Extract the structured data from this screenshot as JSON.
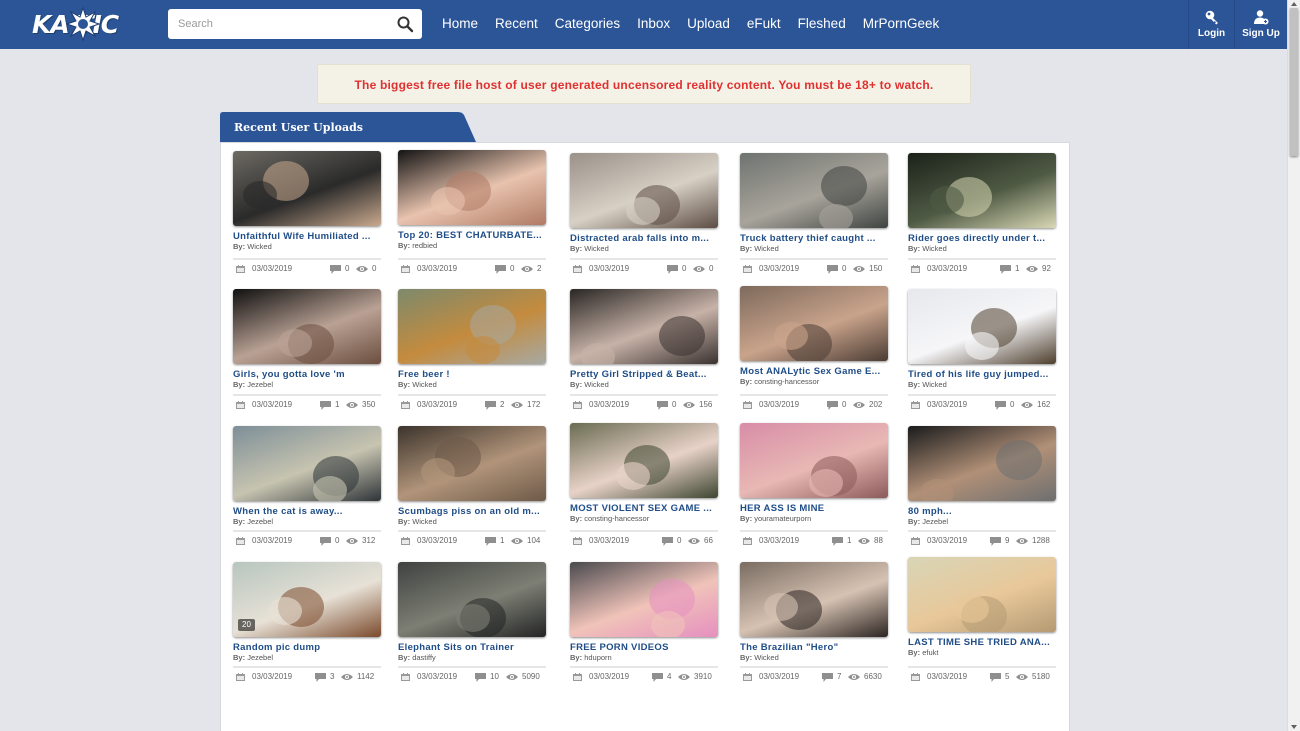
{
  "header": {
    "logo_text": "KA TIC",
    "search": {
      "placeholder": "Search",
      "value": ""
    },
    "nav": [
      "Home",
      "Recent",
      "Categories",
      "Inbox",
      "Upload",
      "eFukt",
      "Fleshed",
      "MrPornGeek"
    ],
    "login_label": "Login",
    "signup_label": "Sign Up",
    "icons": {
      "search": "search-icon",
      "login": "key-icon",
      "signup": "add-user-icon"
    }
  },
  "notice": "The biggest free file host of user generated uncensored reality content. You must be 18+ to watch.",
  "panel": {
    "title": "Recent User Uploads"
  },
  "colors": {
    "header": "#2b5597",
    "link": "#1f4d87",
    "notice_text": "#e03131",
    "notice_bg": "#f4f1e6",
    "page_bg": "#e3e5ea"
  },
  "by_prefix": "By:",
  "uploads": [
    {
      "title": "Unfaithful Wife Humiliated ...",
      "by": "Wicked",
      "date": "03/03/2019",
      "comments": "0",
      "views": "0"
    },
    {
      "title": "Top 20: BEST CHATURBATE...",
      "by": "redbied",
      "date": "03/03/2019",
      "comments": "0",
      "views": "2"
    },
    {
      "title": "Distracted arab falls into m...",
      "by": "Wicked",
      "date": "03/03/2019",
      "comments": "0",
      "views": "0"
    },
    {
      "title": "Truck battery thief caught ...",
      "by": "Wicked",
      "date": "03/03/2019",
      "comments": "0",
      "views": "150"
    },
    {
      "title": "Rider goes directly under t...",
      "by": "Wicked",
      "date": "03/03/2019",
      "comments": "1",
      "views": "92"
    },
    {
      "title": "Girls, you gotta love 'm",
      "by": "Jezebel",
      "date": "03/03/2019",
      "comments": "1",
      "views": "350"
    },
    {
      "title": "Free beer !",
      "by": "Wicked",
      "date": "03/03/2019",
      "comments": "2",
      "views": "172"
    },
    {
      "title": "Pretty Girl Stripped & Beat...",
      "by": "Wicked",
      "date": "03/03/2019",
      "comments": "0",
      "views": "156"
    },
    {
      "title": "Most ANALytic Sex Game E...",
      "by": "consting-hancessor",
      "date": "03/03/2019",
      "comments": "0",
      "views": "202"
    },
    {
      "title": "Tired of his life guy jumped...",
      "by": "Wicked",
      "date": "03/03/2019",
      "comments": "0",
      "views": "162"
    },
    {
      "title": "When the cat is away...",
      "by": "Jezebel",
      "date": "03/03/2019",
      "comments": "0",
      "views": "312"
    },
    {
      "title": "Scumbags piss on an old m...",
      "by": "Wicked",
      "date": "03/03/2019",
      "comments": "1",
      "views": "104"
    },
    {
      "title": "MOST VIOLENT SEX GAME ...",
      "by": "consting-hancessor",
      "date": "03/03/2019",
      "comments": "0",
      "views": "66"
    },
    {
      "title": "HER ASS IS MINE",
      "by": "youramateurporn",
      "date": "03/03/2019",
      "comments": "1",
      "views": "88"
    },
    {
      "title": "80 mph...",
      "by": "Jezebel",
      "date": "03/03/2019",
      "comments": "9",
      "views": "1288"
    },
    {
      "title": "Random pic dump",
      "by": "Jezebel",
      "date": "03/03/2019",
      "comments": "3",
      "views": "1142",
      "badge": "20"
    },
    {
      "title": "Elephant Sits on Trainer",
      "by": "dastiffy",
      "date": "03/03/2019",
      "comments": "10",
      "views": "5090"
    },
    {
      "title": "FREE PORN VIDEOS",
      "by": "hduporn",
      "date": "03/03/2019",
      "comments": "4",
      "views": "3910"
    },
    {
      "title": "The Brazilian \"Hero\"",
      "by": "Wicked",
      "date": "03/03/2019",
      "comments": "7",
      "views": "6630"
    },
    {
      "title": "LAST TIME SHE TRIED ANA...",
      "by": "efukt",
      "date": "03/03/2019",
      "comments": "5",
      "views": "5180"
    }
  ]
}
